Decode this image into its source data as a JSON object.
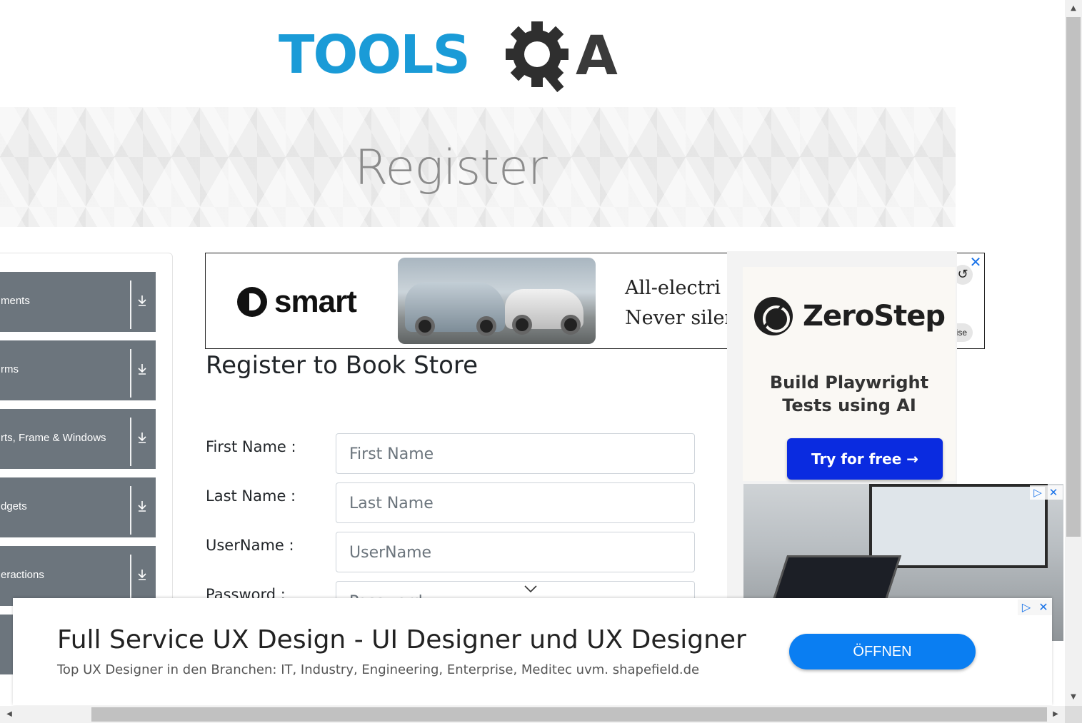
{
  "header": {
    "logo_text": "TOOLSQA",
    "logo_part_tools": "TOOLS",
    "logo_part_a": "A"
  },
  "banner": {
    "title": "Register"
  },
  "sidebar": {
    "items": [
      {
        "label": "ments"
      },
      {
        "label": "rms"
      },
      {
        "label": "rts, Frame & Windows"
      },
      {
        "label": "dgets"
      },
      {
        "label": "eractions"
      },
      {
        "label": ""
      }
    ]
  },
  "ads": {
    "top": {
      "brand": "smart",
      "line1": "All-electri",
      "line2": "Never siler",
      "weise": "eise",
      "close_icon": "close-icon",
      "replay_icon": "replay-icon"
    },
    "right": {
      "brand": "ZeroStep",
      "tagline": "Build Playwright Tests using AI",
      "cta": "Try for free →"
    },
    "bottom": {
      "title": "Full Service UX Design - UI Designer und UX Designer",
      "subtitle": "Top UX Designer in den Branchen: IT, Industry, Engineering, Enterprise, Meditec uvm. shapefield.de",
      "cta": "ÖFFNEN"
    }
  },
  "form": {
    "heading": "Register to Book Store",
    "fields": [
      {
        "label": "First Name :",
        "placeholder": "First Name"
      },
      {
        "label": "Last Name :",
        "placeholder": "Last Name"
      },
      {
        "label": "UserName :",
        "placeholder": "UserName"
      },
      {
        "label": "Password :",
        "placeholder": "Password"
      }
    ]
  },
  "colors": {
    "brand_blue": "#1a9bd7",
    "sidebar_gray": "#6c757d",
    "cta_blue": "#0a7ef2",
    "zerostep_blue": "#0a2be0"
  }
}
